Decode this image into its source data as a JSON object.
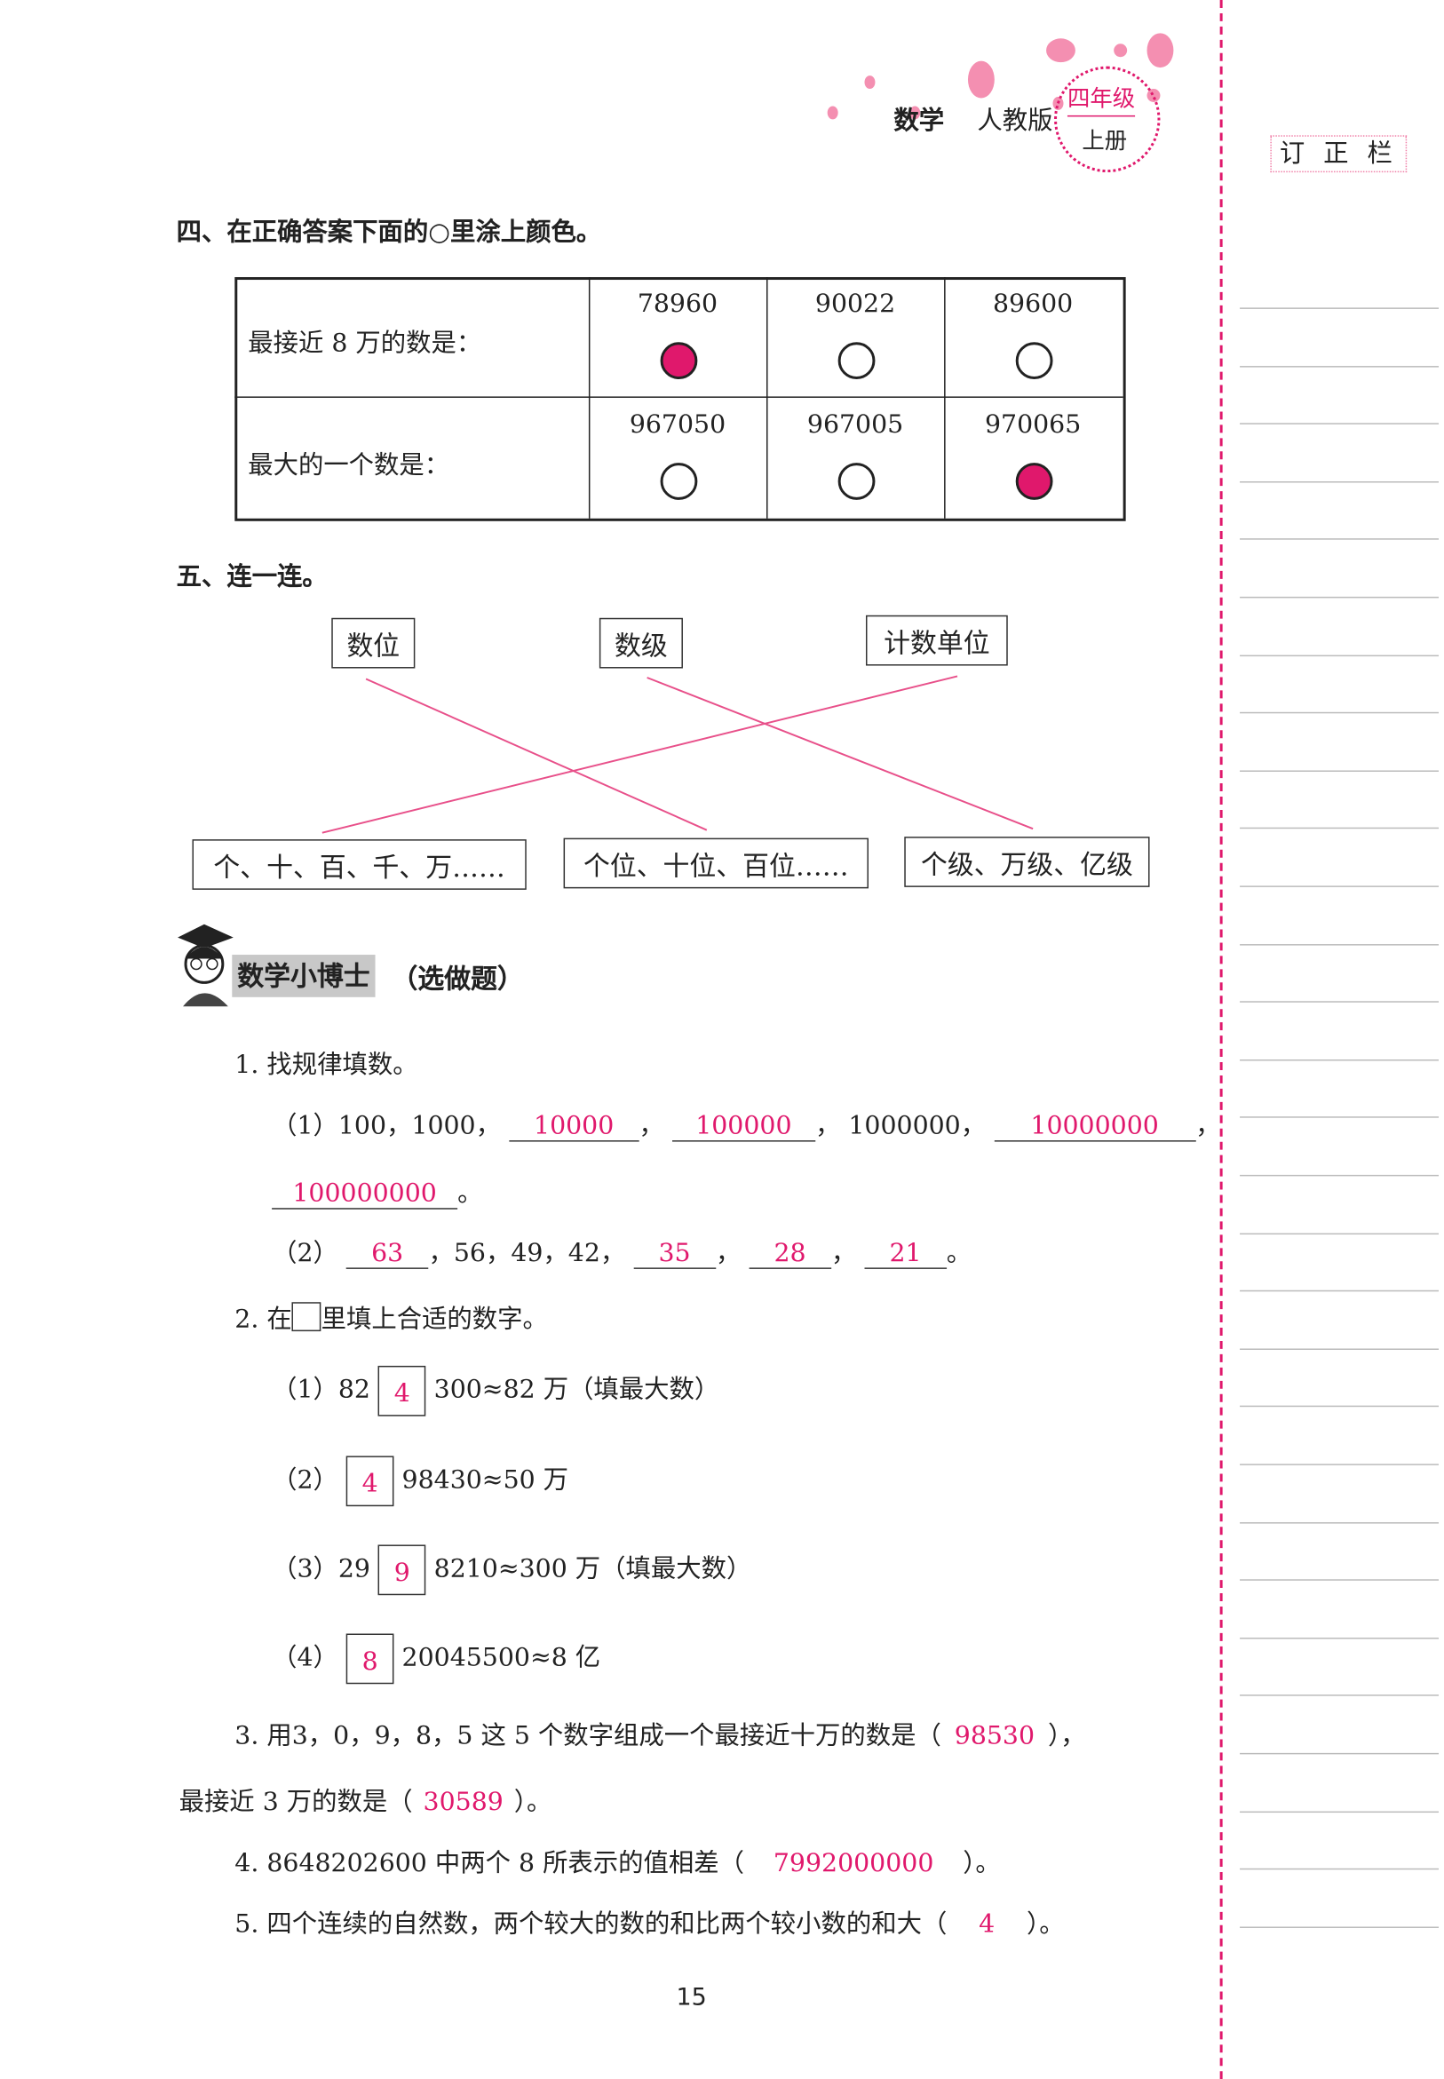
{
  "header": {
    "subject": "数学",
    "edition": "人教版",
    "grade": "四年级",
    "volume": "上册",
    "correction_column": "订 正 栏",
    "accent": "#e0186c"
  },
  "section4": {
    "title": "四、在正确答案下面的○里涂上颜色。",
    "rows": [
      {
        "label": "最接近 8 万的数是：",
        "options": [
          "78960",
          "90022",
          "89600"
        ],
        "filled": [
          true,
          false,
          false
        ]
      },
      {
        "label": "最大的一个数是：",
        "options": [
          "967050",
          "967005",
          "970065"
        ],
        "filled": [
          false,
          false,
          true
        ]
      }
    ]
  },
  "section5": {
    "title": "五、连一连。",
    "top": [
      "数位",
      "数级",
      "计数单位"
    ],
    "bottom": [
      "个、十、百、千、万……",
      "个位、十位、百位……",
      "个级、万级、亿级"
    ],
    "connections": [
      [
        "数位",
        "个位、十位、百位……"
      ],
      [
        "数级",
        "个级、万级、亿级"
      ],
      [
        "计数单位",
        "个、十、百、千、万……"
      ]
    ]
  },
  "bonus": {
    "title": "数学小博士",
    "subtitle": "（选做题）",
    "q1": {
      "title": "1. 找规律填数。",
      "p1": {
        "label": "（1）",
        "a": "100，1000，",
        "ans": [
          "10000",
          "100000",
          "10000000",
          "100000000"
        ],
        "mid": "1000000，"
      },
      "p2": {
        "label": "（2）",
        "ans": [
          "63",
          "35",
          "28",
          "21"
        ],
        "mid": "，56，49，42，"
      }
    },
    "q2": {
      "title_pre": "2. 在",
      "title_post": "里填上合适的数字。",
      "items": [
        {
          "label": "（1）",
          "pre": "82",
          "ans": "4",
          "post": "300≈82 万（填最大数）"
        },
        {
          "label": "（2）",
          "pre": "",
          "ans": "4",
          "post": "98430≈50 万"
        },
        {
          "label": "（3）",
          "pre": "29",
          "ans": "9",
          "post": "8210≈300 万（填最大数）"
        },
        {
          "label": "（4）",
          "pre": "",
          "ans": "8",
          "post": "20045500≈8 亿"
        }
      ]
    },
    "q3": {
      "pre": "3. 用3，0，9，8，5 这 5 个数字组成一个最接近十万的数是（",
      "ans1": "98530",
      "mid": "），",
      "line2": "最接近 3 万的数是（",
      "ans2": "30589",
      "end": "）。"
    },
    "q4": {
      "pre": "4. 8648202600 中两个 8 所表示的值相差（",
      "ans": "7992000000",
      "end": "）。"
    },
    "q5": {
      "pre": "5. 四个连续的自然数，两个较大的数的和比两个较小数的和大（",
      "ans": "4",
      "end": "）。"
    }
  },
  "page_number": "15"
}
